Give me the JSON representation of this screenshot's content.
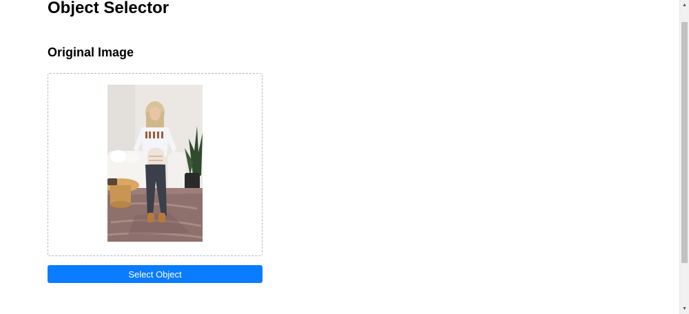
{
  "page": {
    "title": "Object Selector"
  },
  "original_image": {
    "heading": "Original Image"
  },
  "actions": {
    "select_object_label": "Select Object"
  },
  "colors": {
    "primary_button": "#0a7cff",
    "dropzone_border": "#b8b8b8"
  },
  "scrollbar": {
    "up_icon": "triangle-up-icon",
    "down_icon": "triangle-down-icon"
  }
}
